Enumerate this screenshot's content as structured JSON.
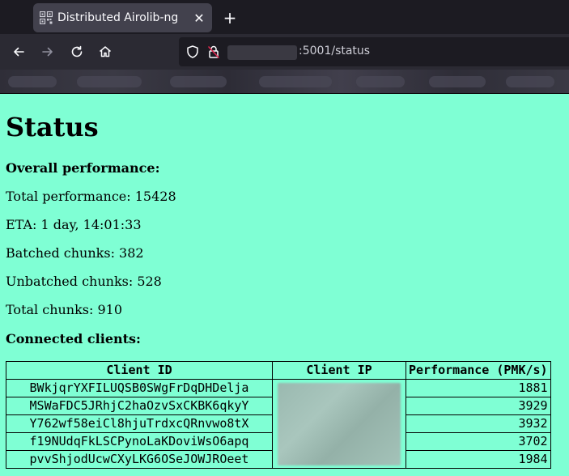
{
  "browser": {
    "tab_title": "Distributed Airolib-ng",
    "new_tab_label": "+",
    "close_label": "✕",
    "url_text": ":5001/status"
  },
  "page": {
    "heading": "Status",
    "overall_label": "Overall performance:",
    "total_performance": "Total performance: 15428",
    "eta": "ETA: 1 day, 14:01:33",
    "batched_chunks": "Batched chunks: 382",
    "unbatched_chunks": "Unbatched chunks: 528",
    "total_chunks": "Total chunks: 910",
    "clients_label": "Connected clients:"
  },
  "table": {
    "headers": [
      "Client ID",
      "Client IP",
      "Performance (PMK/s)"
    ],
    "rows": [
      {
        "id": "BWkjqrYXFILUQSB0SWgFrDqDHDelja",
        "perf": "1881"
      },
      {
        "id": "MSWaFDC5JRhjC2haOzvSxCKBK6qkyY",
        "perf": "3929"
      },
      {
        "id": "Y762wf58eiCl8hjuTrdxcQRnvwo8tX",
        "perf": "3932"
      },
      {
        "id": "f19NUdqFkLSCPynoLaKDoviWsO6apq",
        "perf": "3702"
      },
      {
        "id": "pvvShjodUcwCXyLKG6OSeJOWJROeet",
        "perf": "1984"
      }
    ]
  },
  "colors": {
    "page_background": "#7fffd4",
    "chrome_background": "#1c1b22"
  }
}
